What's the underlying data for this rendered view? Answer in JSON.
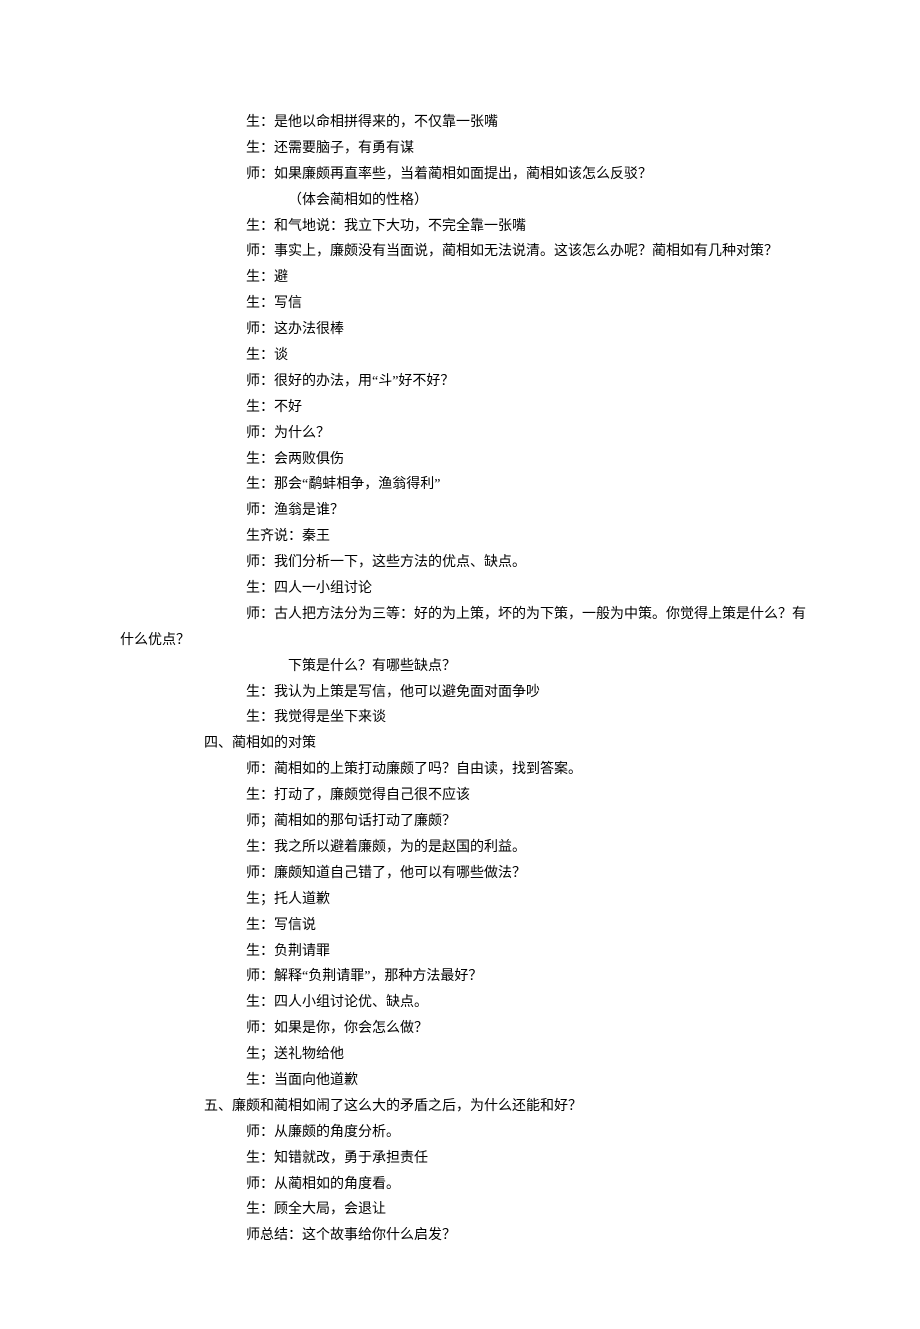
{
  "lines": [
    {
      "cls": "indent-speaker",
      "text": "生：是他以命相拼得来的，不仅靠一张嘴"
    },
    {
      "cls": "indent-speaker",
      "text": "生：还需要脑子，有勇有谋"
    },
    {
      "cls": "indent-speaker",
      "text": "师：如果廉颇再直率些，当着蔺相如面提出，蔺相如该怎么反驳？"
    },
    {
      "cls": "indent-inner",
      "text": "（体会蔺相如的性格）"
    },
    {
      "cls": "indent-speaker",
      "text": "生：和气地说：我立下大功，不完全靠一张嘴"
    },
    {
      "cls": "indent-speaker",
      "text": "师：事实上，廉颇没有当面说，蔺相如无法说清。这该怎么办呢？蔺相如有几种对策？"
    },
    {
      "cls": "indent-speaker",
      "text": "生：避"
    },
    {
      "cls": "indent-speaker",
      "text": "生：写信"
    },
    {
      "cls": "indent-speaker",
      "text": "师：这办法很棒"
    },
    {
      "cls": "indent-speaker",
      "text": "生：谈"
    },
    {
      "cls": "indent-speaker",
      "text": "师：很好的办法，用“斗”好不好？"
    },
    {
      "cls": "indent-speaker",
      "text": "生：不好"
    },
    {
      "cls": "indent-speaker",
      "text": "师：为什么？"
    },
    {
      "cls": "indent-speaker",
      "text": "生：会两败俱伤"
    },
    {
      "cls": "indent-speaker",
      "text": "生：那会“鹬蚌相争，渔翁得利”"
    },
    {
      "cls": "indent-speaker",
      "text": "师：渔翁是谁？"
    },
    {
      "cls": "indent-speaker",
      "text": "生齐说：秦王"
    },
    {
      "cls": "indent-speaker",
      "text": "师：我们分析一下，这些方法的优点、缺点。"
    },
    {
      "cls": "indent-speaker",
      "text": "生：四人一小组讨论"
    },
    {
      "cls": "indent-speaker",
      "text": "师：古人把方法分为三等：好的为上策，坏的为下策，一般为中策。你觉得上策是什么？有"
    },
    {
      "cls": "no-indent",
      "text": "什么优点？"
    },
    {
      "cls": "indent-inner",
      "text": "下策是什么？有哪些缺点？"
    },
    {
      "cls": "indent-speaker",
      "text": "生：我认为上策是写信，他可以避免面对面争吵"
    },
    {
      "cls": "indent-speaker",
      "text": "生：我觉得是坐下来谈"
    },
    {
      "cls": "indent-section",
      "text": "四、蔺相如的对策"
    },
    {
      "cls": "indent-speaker",
      "text": "师：蔺相如的上策打动廉颇了吗？自由读，找到答案。"
    },
    {
      "cls": "indent-speaker",
      "text": "生：打动了，廉颇觉得自己很不应该"
    },
    {
      "cls": "indent-speaker",
      "text": "师；蔺相如的那句话打动了廉颇？"
    },
    {
      "cls": "indent-speaker",
      "text": "生：我之所以避着廉颇，为的是赵国的利益。"
    },
    {
      "cls": "indent-speaker",
      "text": "师：廉颇知道自己错了，他可以有哪些做法？"
    },
    {
      "cls": "indent-speaker",
      "text": "生；托人道歉"
    },
    {
      "cls": "indent-speaker",
      "text": "生：写信说"
    },
    {
      "cls": "indent-speaker",
      "text": "生：负荆请罪"
    },
    {
      "cls": "indent-speaker",
      "text": "师：解释“负荆请罪”，那种方法最好？"
    },
    {
      "cls": "indent-speaker",
      "text": "生：四人小组讨论优、缺点。"
    },
    {
      "cls": "indent-speaker",
      "text": "师：如果是你，你会怎么做？"
    },
    {
      "cls": "indent-speaker",
      "text": "生；送礼物给他"
    },
    {
      "cls": "indent-speaker",
      "text": "生：当面向他道歉"
    },
    {
      "cls": "indent-section",
      "text": "五、廉颇和蔺相如闹了这么大的矛盾之后，为什么还能和好？"
    },
    {
      "cls": "indent-speaker",
      "text": "师：从廉颇的角度分析。"
    },
    {
      "cls": "indent-speaker",
      "text": "生：知错就改，勇于承担责任"
    },
    {
      "cls": "indent-speaker",
      "text": "师：从蔺相如的角度看。"
    },
    {
      "cls": "indent-speaker",
      "text": "生：顾全大局，会退让"
    },
    {
      "cls": "indent-speaker",
      "text": "师总结：这个故事给你什么启发？"
    }
  ]
}
